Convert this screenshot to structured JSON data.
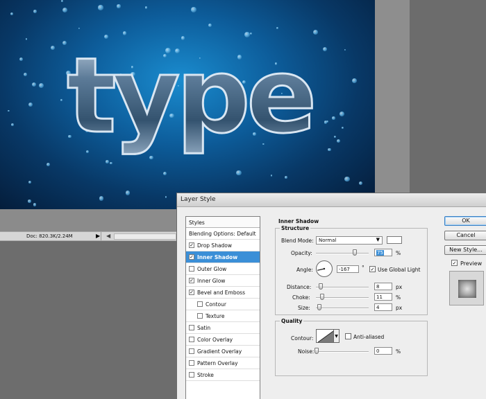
{
  "canvas": {
    "text": "type"
  },
  "status_bar": {
    "doc": "Doc: 820.3K/2.24M"
  },
  "dialog": {
    "title": "Layer Style",
    "styles_list": {
      "header": "Styles",
      "blending": "Blending Options: Default",
      "items": [
        {
          "label": "Drop Shadow",
          "checked": true,
          "check_mark": "✓"
        },
        {
          "label": "Inner Shadow",
          "checked": true,
          "check_mark": "✓",
          "selected": true
        },
        {
          "label": "Outer Glow",
          "checked": false,
          "check_mark": ""
        },
        {
          "label": "Inner Glow",
          "checked": true,
          "check_mark": "✓"
        },
        {
          "label": "Bevel and Emboss",
          "checked": true,
          "check_mark": "✓"
        },
        {
          "label": "Contour",
          "checked": false,
          "check_mark": "",
          "sub": true
        },
        {
          "label": "Texture",
          "checked": false,
          "check_mark": "",
          "sub": true
        },
        {
          "label": "Satin",
          "checked": false,
          "check_mark": ""
        },
        {
          "label": "Color Overlay",
          "checked": false,
          "check_mark": ""
        },
        {
          "label": "Gradient Overlay",
          "checked": false,
          "check_mark": ""
        },
        {
          "label": "Pattern Overlay",
          "checked": false,
          "check_mark": ""
        },
        {
          "label": "Stroke",
          "checked": false,
          "check_mark": ""
        }
      ]
    },
    "panel": {
      "title": "Inner Shadow",
      "structure": {
        "legend": "Structure",
        "blend_mode_label": "Blend Mode:",
        "blend_mode_value": "Normal",
        "blend_color": "#ffffff",
        "opacity_label": "Opacity:",
        "opacity_value": "75",
        "opacity_unit": "%",
        "angle_label": "Angle:",
        "angle_value": "-167",
        "angle_unit": "°",
        "global_light_label": "Use Global Light",
        "global_light_mark": "✓",
        "distance_label": "Distance:",
        "distance_value": "8",
        "distance_unit": "px",
        "choke_label": "Choke:",
        "choke_value": "11",
        "choke_unit": "%",
        "size_label": "Size:",
        "size_value": "4",
        "size_unit": "px"
      },
      "quality": {
        "legend": "Quality",
        "contour_label": "Contour:",
        "anti_alias_label": "Anti-aliased",
        "noise_label": "Noise:",
        "noise_value": "0",
        "noise_unit": "%"
      }
    },
    "buttons": {
      "ok": "OK",
      "cancel": "Cancel",
      "new_style": "New Style...",
      "preview_label": "Preview",
      "preview_mark": "✓"
    }
  }
}
